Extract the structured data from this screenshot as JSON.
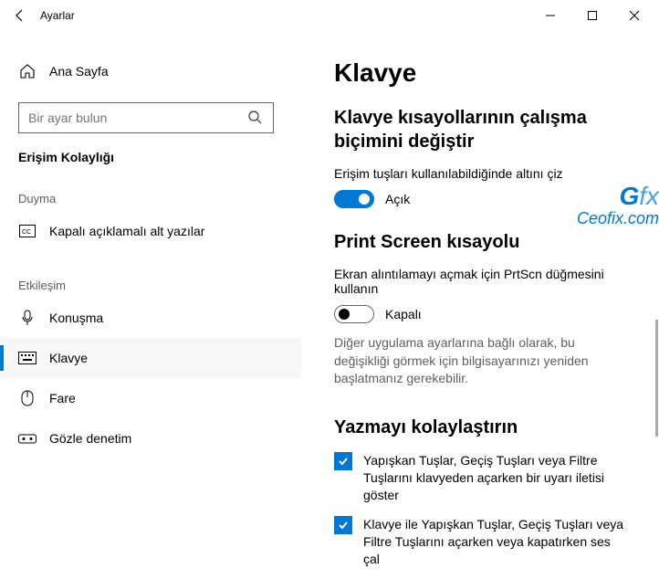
{
  "titlebar": {
    "title": "Ayarlar"
  },
  "sidebar": {
    "home": "Ana Sayfa",
    "search_placeholder": "Bir ayar bulun",
    "section_active": "Erişim Kolaylığı",
    "groups": {
      "hearing": "Duyma",
      "interaction": "Etkileşim"
    },
    "items": {
      "closed_captions": "Kapalı açıklamalı alt yazılar",
      "speech": "Konuşma",
      "keyboard": "Klavye",
      "mouse": "Fare",
      "eye_control": "Gözle denetim"
    }
  },
  "main": {
    "title": "Klavye",
    "sec_shortcut": {
      "heading": "Klavye kısayollarının çalışma biçimini değiştir",
      "desc": "Erişim tuşları kullanılabildiğinde altını çiz",
      "toggle_state": "Açık"
    },
    "sec_prtscn": {
      "heading": "Print Screen kısayolu",
      "desc": "Ekran alıntılamayı açmak için PrtScn düğmesini kullanın",
      "toggle_state": "Kapalı",
      "hint": "Diğer uygulama ayarlarına bağlı olarak, bu değişikliği görmek için bilgisayarınızı yeniden başlatmanız gerekebilir."
    },
    "sec_typing": {
      "heading": "Yazmayı kolaylaştırın",
      "check1": "Yapışkan Tuşlar, Geçiş Tuşları veya Filtre Tuşlarını klavyeden açarken bir uyarı iletisi göster",
      "check2": "Klavye ile Yapışkan Tuşlar, Geçiş Tuşları veya Filtre Tuşlarını açarken veya kapatırken ses çal"
    }
  },
  "watermark": {
    "brand_g": "G",
    "brand_fx": "fx",
    "site": "Ceofix.com"
  }
}
